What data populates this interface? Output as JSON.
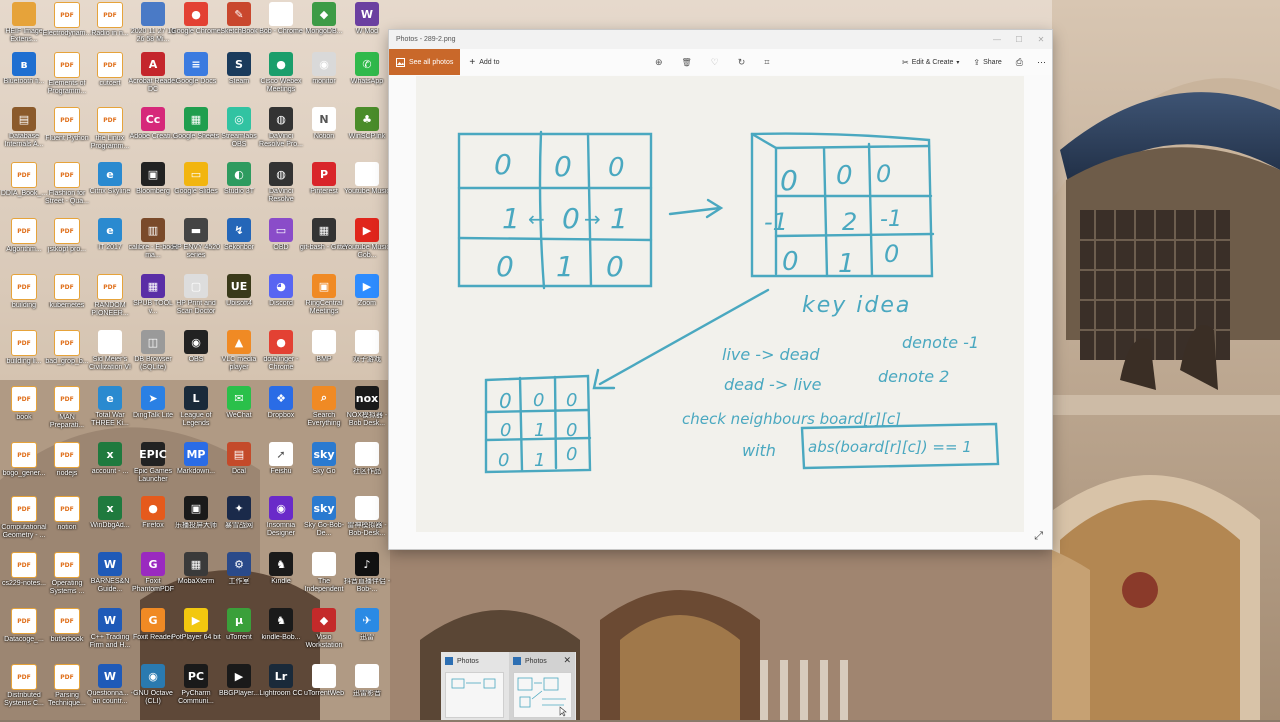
{
  "desktop": {
    "icons": [
      {
        "label": "HEIF Image Extens...",
        "color": "#e6a33a",
        "glyph": ""
      },
      {
        "label": "Electrodynam...",
        "color": "#f0a03a",
        "glyph": "PDF"
      },
      {
        "label": "Radio in n...",
        "color": "#f0a03a",
        "glyph": "PDF"
      },
      {
        "label": "2020 11 27 15 26 58 Mi...",
        "color": "#4a7ac6",
        "glyph": ""
      },
      {
        "label": "Google Chrome",
        "color": "#e34133",
        "glyph": "●"
      },
      {
        "label": "SketchBook",
        "color": "#c9472d",
        "glyph": "✎"
      },
      {
        "label": "Bob - Chrome",
        "color": "#ffffff",
        "glyph": ""
      },
      {
        "label": "MongoDB...",
        "color": "#3d9b46",
        "glyph": "◆"
      },
      {
        "label": "W Mod",
        "color": "#6b3fa0",
        "glyph": "W"
      },
      {
        "label": "Bluetooth fi...",
        "color": "#1f6fd1",
        "glyph": "ʙ"
      },
      {
        "label": "Elements of Programm...",
        "color": "#f0a03a",
        "glyph": "PDF"
      },
      {
        "label": "cutcert",
        "color": "#f0a03a",
        "glyph": "PDF"
      },
      {
        "label": "Acrobat Reader DC",
        "color": "#c4262c",
        "glyph": "A"
      },
      {
        "label": "Google Docs",
        "color": "#3b7be0",
        "glyph": "≡"
      },
      {
        "label": "Steam",
        "color": "#1a3b5c",
        "glyph": "S"
      },
      {
        "label": "Cisco Webex Meetings",
        "color": "#1a9e6b",
        "glyph": "●"
      },
      {
        "label": "monitor",
        "color": "#d9d9d9",
        "glyph": "◉"
      },
      {
        "label": "WhatsApp",
        "color": "#30b94b",
        "glyph": "✆"
      },
      {
        "label": "Database Internals A...",
        "color": "#8b5a2b",
        "glyph": "▤"
      },
      {
        "label": "Fluent Python",
        "color": "#f0a03a",
        "glyph": "PDF"
      },
      {
        "label": "the Linux Programm...",
        "color": "#f0a03a",
        "glyph": "PDF"
      },
      {
        "label": "Adobe Creati...",
        "color": "#d6287a",
        "glyph": "Cc"
      },
      {
        "label": "Google Sheets",
        "color": "#1f9e4e",
        "glyph": "▦"
      },
      {
        "label": "Streamlabs OBS",
        "color": "#31c3a2",
        "glyph": "◎"
      },
      {
        "label": "DaVinci Resolve Pro...",
        "color": "#333333",
        "glyph": "◍"
      },
      {
        "label": "Notion",
        "color": "#ffffff",
        "glyph": "N"
      },
      {
        "label": "WinSCP.lnk",
        "color": "#4a8c2a",
        "glyph": "♣"
      },
      {
        "label": "DDIA_Book_...",
        "color": "#f0a03a",
        "glyph": "PDF"
      },
      {
        "label": "Flashion for Street - Qua...",
        "color": "#f0a03a",
        "glyph": "PDF"
      },
      {
        "label": "Citrix Skyline",
        "color": "#2a8ad0",
        "glyph": "e"
      },
      {
        "label": "Bloomberg",
        "color": "#222222",
        "glyph": "▣"
      },
      {
        "label": "Google Slides",
        "color": "#f2b50f",
        "glyph": "▭"
      },
      {
        "label": "Studio 3T",
        "color": "#2e9b5f",
        "glyph": "◐"
      },
      {
        "label": "DaVinci Resolve",
        "color": "#333333",
        "glyph": "◍"
      },
      {
        "label": "Pinterest",
        "color": "#d9252a",
        "glyph": "P"
      },
      {
        "label": "Youtube Music",
        "color": "#ffffff",
        "glyph": ""
      },
      {
        "label": "Algorithm...",
        "color": "#f0a03a",
        "glyph": "PDF"
      },
      {
        "label": "jstkopf pro...",
        "color": "#f0a03a",
        "glyph": "PDF"
      },
      {
        "label": "IT 2017",
        "color": "#2a8ad0",
        "glyph": "e"
      },
      {
        "label": "calibre - E-book ma...",
        "color": "#7a4a2a",
        "glyph": "▥"
      },
      {
        "label": "HP ENVY 4520 series",
        "color": "#444444",
        "glyph": "▬"
      },
      {
        "label": "Sekonbor",
        "color": "#2466b8",
        "glyph": "↯"
      },
      {
        "label": "OBD",
        "color": "#8a4cc9",
        "glyph": "▭"
      },
      {
        "label": "git-bash - Gitter",
        "color": "#333333",
        "glyph": "▦"
      },
      {
        "label": "Youtube Music Gob...",
        "color": "#e0261c",
        "glyph": "▶"
      },
      {
        "label": "building",
        "color": "#f0a03a",
        "glyph": "PDF"
      },
      {
        "label": "kubernetes",
        "color": "#f0a03a",
        "glyph": "PDF"
      },
      {
        "label": "RANDOM PIONEER...",
        "color": "#f0a03a",
        "glyph": "PDF"
      },
      {
        "label": "SPUB TOOL v...",
        "color": "#5a2ea6",
        "glyph": "▦"
      },
      {
        "label": "HP Print and Scan Doctor",
        "color": "#dddddd",
        "glyph": "▢"
      },
      {
        "label": "Ubisoft4",
        "color": "#3a3a1a",
        "glyph": "UE"
      },
      {
        "label": "Discord",
        "color": "#5865f2",
        "glyph": "◕"
      },
      {
        "label": "RingCentral Meetings",
        "color": "#f08a24",
        "glyph": "▣"
      },
      {
        "label": "Zoom",
        "color": "#2d8cff",
        "glyph": "▶"
      },
      {
        "label": "building li...",
        "color": "#f0a03a",
        "glyph": "PDF"
      },
      {
        "label": "bad_grop_b...",
        "color": "#f0a03a",
        "glyph": "PDF"
      },
      {
        "label": "Sid Meier's Civilization VI",
        "color": "#ffffff",
        "glyph": ""
      },
      {
        "label": "DB Browser (SQLite)",
        "color": "#9a9a9a",
        "glyph": "◫"
      },
      {
        "label": "OBS",
        "color": "#222222",
        "glyph": "◉"
      },
      {
        "label": "VLC media player",
        "color": "#f08a24",
        "glyph": "▲"
      },
      {
        "label": "dotalinger - Chrome",
        "color": "#e34133",
        "glyph": "●"
      },
      {
        "label": "BMP",
        "color": "#ffffff",
        "glyph": ""
      },
      {
        "label": "双子游戏",
        "color": "#ffffff",
        "glyph": ""
      },
      {
        "label": "book",
        "color": "#f0a03a",
        "glyph": "PDF"
      },
      {
        "label": "MAN Preparati...",
        "color": "#f0a03a",
        "glyph": "PDF"
      },
      {
        "label": "Total War THREE Ki...",
        "color": "#2a8ad0",
        "glyph": "e"
      },
      {
        "label": "DingTalk Lite",
        "color": "#2a80e4",
        "glyph": "➤"
      },
      {
        "label": "League of Legends",
        "color": "#1a2a3a",
        "glyph": "L"
      },
      {
        "label": "WeChat",
        "color": "#2ac04a",
        "glyph": "✉"
      },
      {
        "label": "Dropbox",
        "color": "#2a6ce6",
        "glyph": "❖"
      },
      {
        "label": "Search Everything",
        "color": "#f08a24",
        "glyph": "⌕"
      },
      {
        "label": "NOX模拟器 - Bob Desk...",
        "color": "#1a1a1a",
        "glyph": "nox"
      },
      {
        "label": "bogo_gener...",
        "color": "#f0a03a",
        "glyph": "PDF"
      },
      {
        "label": "nodejs",
        "color": "#f0a03a",
        "glyph": "PDF"
      },
      {
        "label": "account - ...",
        "color": "#1f7a3e",
        "glyph": "x"
      },
      {
        "label": "Epic Games Launcher",
        "color": "#222222",
        "glyph": "EPIC"
      },
      {
        "label": "Markdown...",
        "color": "#2a6ce6",
        "glyph": "MP"
      },
      {
        "label": "Dcal",
        "color": "#c44a2a",
        "glyph": "▤"
      },
      {
        "label": "Feishu",
        "color": "#ffffff",
        "glyph": "➚"
      },
      {
        "label": "Sky Go",
        "color": "#2a7ad0",
        "glyph": "sky"
      },
      {
        "label": "社区作品",
        "color": "#ffffff",
        "glyph": ""
      },
      {
        "label": "Computational Geometry - ...",
        "color": "#f0a03a",
        "glyph": "PDF"
      },
      {
        "label": "notion",
        "color": "#f0a03a",
        "glyph": "PDF"
      },
      {
        "label": "WinDbgAd...",
        "color": "#1f7a3e",
        "glyph": "x"
      },
      {
        "label": "Firefox",
        "color": "#e55a1c",
        "glyph": "●"
      },
      {
        "label": "乐播投屏大师",
        "color": "#1a1a1a",
        "glyph": "▣"
      },
      {
        "label": "暴雪战网",
        "color": "#1a2a4a",
        "glyph": "✦"
      },
      {
        "label": "Insomnia Designer",
        "color": "#6a2ac9",
        "glyph": "◉"
      },
      {
        "label": "Sky Go-Bob-De...",
        "color": "#2a7ad0",
        "glyph": "sky"
      },
      {
        "label": "雷神模拟器 -Bob-Desk...",
        "color": "#ffffff",
        "glyph": ""
      },
      {
        "label": "cs229-notes...",
        "color": "#f0a03a",
        "glyph": "PDF"
      },
      {
        "label": "Operating Systems ...",
        "color": "#f0a03a",
        "glyph": "PDF"
      },
      {
        "label": "BARNES&N Guide...",
        "color": "#1f5ab8",
        "glyph": "W"
      },
      {
        "label": "Foxit PhantomPDF",
        "color": "#9a2ac0",
        "glyph": "G"
      },
      {
        "label": "MobaXterm",
        "color": "#3a3a3a",
        "glyph": "▦"
      },
      {
        "label": "工作室",
        "color": "#2a4a8a",
        "glyph": "⚙"
      },
      {
        "label": "Kindle",
        "color": "#1a1a1a",
        "glyph": "♞"
      },
      {
        "label": "The Independent",
        "color": "#ffffff",
        "glyph": ""
      },
      {
        "label": "抖音直播伴侣 - Bob-...",
        "color": "#111111",
        "glyph": "♪"
      },
      {
        "label": "Datacoge_...",
        "color": "#f0a03a",
        "glyph": "PDF"
      },
      {
        "label": "butlerbook",
        "color": "#f0a03a",
        "glyph": "PDF"
      },
      {
        "label": "C++ Trading Firm and H...",
        "color": "#1f5ab8",
        "glyph": "W"
      },
      {
        "label": "Foxit Reader",
        "color": "#f08a24",
        "glyph": "G"
      },
      {
        "label": "PotPlayer 64 bit",
        "color": "#f2c80f",
        "glyph": "▶"
      },
      {
        "label": "uTorrent",
        "color": "#3aa03a",
        "glyph": "µ"
      },
      {
        "label": "kindle-Bob...",
        "color": "#1a1a1a",
        "glyph": "♞"
      },
      {
        "label": "Visio Workstation",
        "color": "#c42a2a",
        "glyph": "◆"
      },
      {
        "label": "迅雷",
        "color": "#2a8ae4",
        "glyph": "✈"
      },
      {
        "label": "Distributed Systems C...",
        "color": "#f0a03a",
        "glyph": "PDF"
      },
      {
        "label": "Parsing Technique...",
        "color": "#f0a03a",
        "glyph": "PDF"
      },
      {
        "label": "Questionna... - an countr...",
        "color": "#1f5ab8",
        "glyph": "W"
      },
      {
        "label": "GNU Octave (CLI)",
        "color": "#2a7ab0",
        "glyph": "◉"
      },
      {
        "label": "PyCharm Communi...",
        "color": "#1a1a1a",
        "glyph": "PC"
      },
      {
        "label": "BBGPlayer...",
        "color": "#1a1a1a",
        "glyph": "▶"
      },
      {
        "label": "Lightroom CC",
        "color": "#1a2a3a",
        "glyph": "Lr"
      },
      {
        "label": "uTorrentWeb",
        "color": "#ffffff",
        "glyph": ""
      },
      {
        "label": "迅雷影音",
        "color": "#ffffff",
        "glyph": ""
      }
    ]
  },
  "window": {
    "title": "Photos - 289-2.png",
    "controls": {
      "minimize": "—",
      "maximize": "☐",
      "close": "✕"
    },
    "toolbar": {
      "see_all_label": "See all photos",
      "add_to_label": "Add to",
      "zoom_icon": "⊕",
      "delete_icon": "🗑",
      "favorite_icon": "♡",
      "rotate_icon": "↻",
      "crop_icon": "⌗",
      "edit_create_label": "Edit & Create",
      "share_label": "Share",
      "print_icon": "⎙",
      "more_icon": "⋯"
    },
    "expand_icon": "⤢"
  },
  "note": {
    "grid1": [
      [
        "0",
        "0",
        "0"
      ],
      [
        "1",
        "0",
        "1"
      ],
      [
        "0",
        "1",
        "0"
      ]
    ],
    "grid1_arrows": [
      "←",
      "→"
    ],
    "grid2": [
      [
        "0",
        "0",
        "0"
      ],
      [
        "-1",
        "2",
        "-1"
      ],
      [
        "0",
        "1",
        "0"
      ]
    ],
    "grid3": [
      [
        "0",
        "0",
        "0"
      ],
      [
        "0",
        "1",
        "0"
      ],
      [
        "0",
        "1",
        "0"
      ]
    ],
    "key_idea": "key idea",
    "line1": "live -> dead",
    "line1_note": "denote -1",
    "line2": "dead -> live",
    "line2_note": "denote 2",
    "line3": "check neighbours board[r][c]",
    "line4_prefix": "with",
    "line4_boxed": "abs(board[r][c]) == 1",
    "ink_color": "#4aa8c0"
  },
  "taskbar_preview": {
    "items": [
      {
        "label": "Photos"
      },
      {
        "label": "Photos",
        "close": "✕"
      }
    ]
  }
}
